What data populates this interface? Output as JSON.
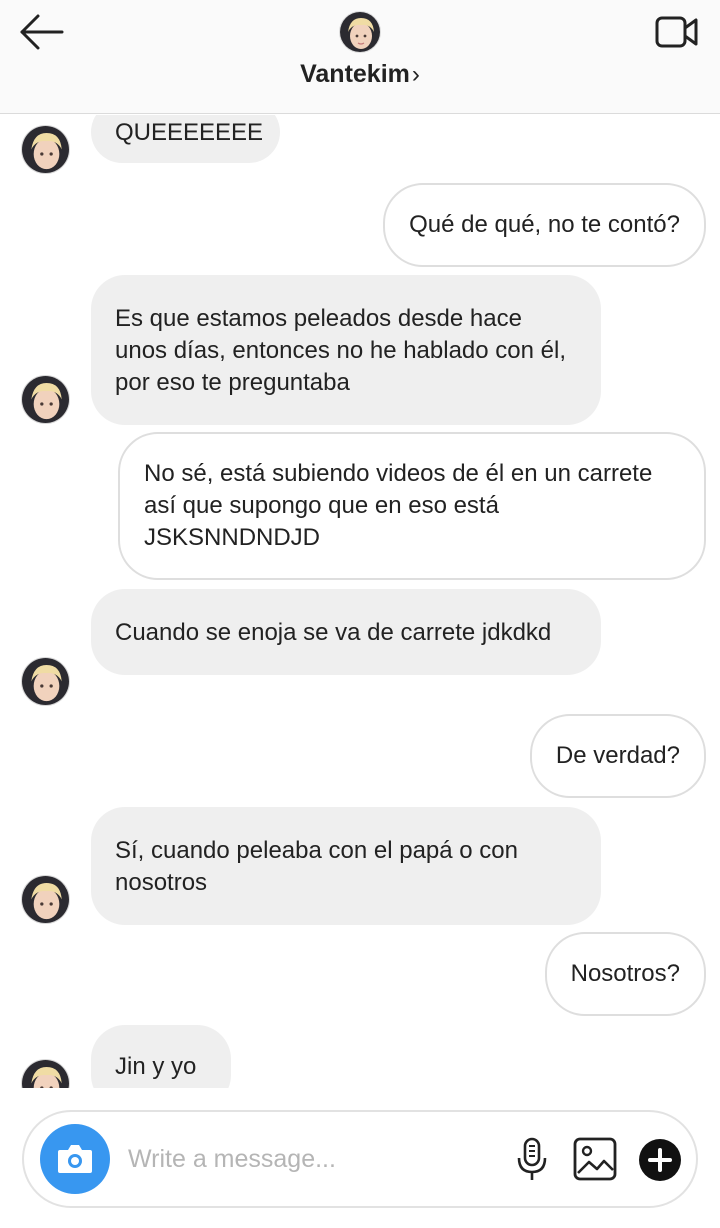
{
  "header": {
    "title": "Vantekim",
    "chevron": "›",
    "back_icon": "arrow-left-icon",
    "video_icon": "video-camera-icon"
  },
  "messages": [
    {
      "side": "in",
      "text": "QUEEEEEEE"
    },
    {
      "side": "out",
      "text": "Qué de qué, no te contó?"
    },
    {
      "side": "in",
      "text": "Es que estamos peleados desde hace unos días, entonces no he hablado con él, por eso te preguntaba"
    },
    {
      "side": "out",
      "text": "No sé, está subiendo videos de él en un carrete así que supongo que en eso está JSKSNNDNDJD"
    },
    {
      "side": "in",
      "text": "Cuando se enoja se va de carrete jdkdkd"
    },
    {
      "side": "out",
      "text": "De verdad?"
    },
    {
      "side": "in",
      "text": "Sí, cuando peleaba con el papá o con nosotros"
    },
    {
      "side": "out",
      "text": "Nosotros?"
    },
    {
      "side": "in",
      "text": "Jin y yo"
    }
  ],
  "composer": {
    "placeholder": "Write a message...",
    "value": "",
    "icons": [
      "camera-icon",
      "microphone-icon",
      "gallery-icon",
      "plus-icon"
    ]
  },
  "colors": {
    "accent": "#3897f0",
    "incoming_bubble": "#efefef",
    "outgoing_border": "#dedede",
    "header_bg": "#fafafa"
  }
}
